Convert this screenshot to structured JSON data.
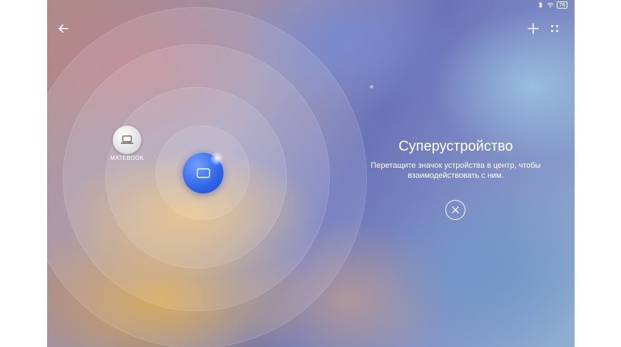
{
  "statusbar": {
    "icons": [
      "bluetooth-icon",
      "wifi-icon",
      "battery-icon"
    ],
    "battery_level": "76"
  },
  "toolbar": {
    "back_icon": "back-arrow-icon",
    "add_icon": "plus-icon",
    "more_icon": "grid-dots-icon"
  },
  "devices": [
    {
      "label": "MATEBOOK",
      "icon": "laptop-icon"
    }
  ],
  "center_device": {
    "icon": "tablet-icon",
    "color": "#2f64e8"
  },
  "main": {
    "title": "Суперустройство",
    "subtitle": "Перетащите значок устройства в центр, чтобы взаимодействовать с ним."
  },
  "close_icon": "close-icon"
}
